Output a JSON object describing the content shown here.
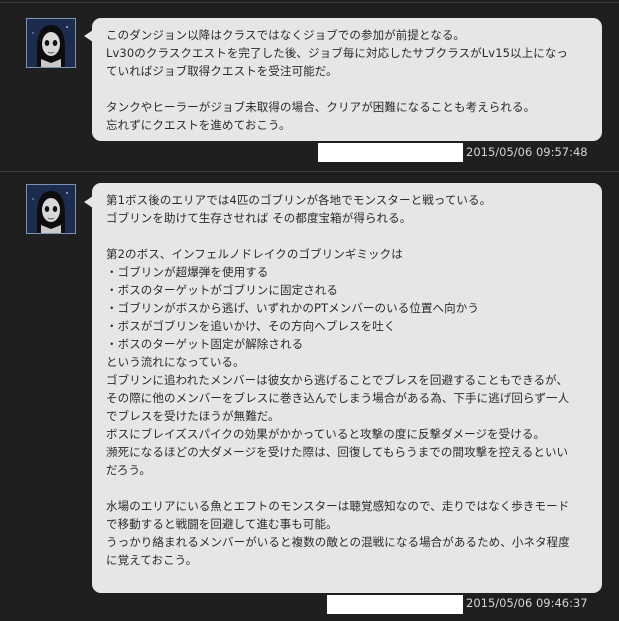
{
  "messages": [
    {
      "avatar": "masked-character-avatar",
      "lines": [
        "このダンジョン以降はクラスではなくジョブでの参加が前提となる。",
        "Lv30のクラスクエストを完了した後、ジョブ毎に対応したサブクラスがLv15以上になっ",
        "ていればジョブ取得クエストを受注可能だ。",
        "",
        "タンクやヒーラーがジョブ未取得の場合、クリアが困難になることも考えられる。",
        "忘れずにクエストを進めておこう。"
      ],
      "timestamp": "2015/05/06 09:57:48"
    },
    {
      "avatar": "masked-character-avatar",
      "lines": [
        "第1ボス後のエリアでは4匹のゴブリンが各地でモンスターと戦っている。",
        "ゴブリンを助けて生存させれば その都度宝箱が得られる。",
        "",
        "第2のボス、インフェルノドレイクのゴブリンギミックは",
        "・ゴブリンが超爆弾を使用する",
        "・ボスのターゲットがゴブリンに固定される",
        "・ゴブリンがボスから逃げ、いずれかのPTメンバーのいる位置へ向かう",
        "・ボスがゴブリンを追いかけ、その方向へブレスを吐く",
        "・ボスのターゲット固定が解除される",
        "という流れになっている。",
        "ゴブリンに追われたメンバーは彼女から逃げることでブレスを回避することもできるが、",
        "その際に他のメンバーをブレスに巻き込んでしまう場合がある為、下手に逃げ回らず一人",
        "でブレスを受けたほうが無難だ。",
        "ボスにブレイズスパイクの効果がかかっていると攻撃の度に反撃ダメージを受ける。",
        "瀕死になるほどの大ダメージを受けた際は、回復してもらうまでの間攻撃を控えるといい",
        "だろう。",
        "",
        "水場のエリアにいる魚とエフトのモンスターは聴覚感知なので、走りではなく歩きモード",
        "で移動すると戦闘を回避して進む事も可能。",
        "うっかり絡まれるメンバーがいると複数の敵との混戦になる場合があるため、小ネタ程度",
        "に覚えておこう。"
      ],
      "timestamp": "2015/05/06 09:46:37"
    }
  ]
}
